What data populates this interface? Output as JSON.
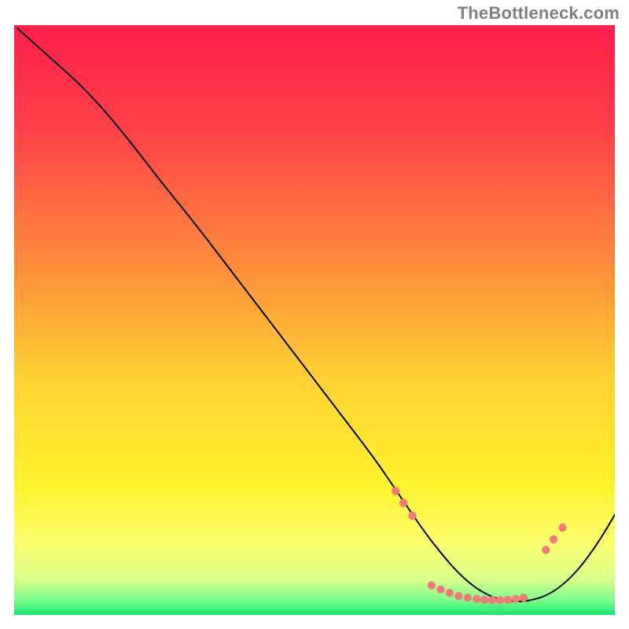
{
  "watermark": "TheBottleneck.com",
  "chart_data": {
    "type": "line",
    "title": "",
    "xlabel": "",
    "ylabel": "",
    "xlim": [
      0,
      100
    ],
    "ylim": [
      0,
      100
    ],
    "gradient_stops": [
      {
        "offset": 0.0,
        "color": "#ff1f4b"
      },
      {
        "offset": 0.18,
        "color": "#ff4249"
      },
      {
        "offset": 0.4,
        "color": "#ff8a3c"
      },
      {
        "offset": 0.6,
        "color": "#ffd233"
      },
      {
        "offset": 0.78,
        "color": "#fff22e"
      },
      {
        "offset": 0.88,
        "color": "#fdff6f"
      },
      {
        "offset": 0.94,
        "color": "#d8ff8a"
      },
      {
        "offset": 0.975,
        "color": "#7bff8e"
      },
      {
        "offset": 1.0,
        "color": "#19e56b"
      }
    ],
    "series": [
      {
        "name": "curve",
        "color": "#000000",
        "width": 2.0,
        "x": [
          0.5,
          6,
          12,
          18,
          24,
          30,
          36,
          42,
          48,
          54,
          60,
          64,
          68,
          71,
          74,
          77,
          80,
          83,
          86,
          89,
          92,
          95,
          98,
          100
        ],
        "y": [
          99.5,
          94.5,
          89,
          82,
          74,
          66.5,
          58.5,
          50.5,
          42.5,
          34.5,
          26.5,
          20.5,
          14.5,
          10.5,
          7.0,
          4.4,
          2.8,
          2.2,
          2.4,
          3.4,
          5.6,
          9.0,
          13.5,
          17.0
        ]
      }
    ],
    "markers": {
      "color": "#f47a7a",
      "radius": 5.2,
      "points": [
        {
          "x": 63.5,
          "y": 21.0
        },
        {
          "x": 64.8,
          "y": 19.0
        },
        {
          "x": 66.3,
          "y": 16.8
        },
        {
          "x": 69.5,
          "y": 5.0
        },
        {
          "x": 71.0,
          "y": 4.3
        },
        {
          "x": 72.5,
          "y": 3.7
        },
        {
          "x": 74.0,
          "y": 3.2
        },
        {
          "x": 75.5,
          "y": 2.9
        },
        {
          "x": 77.0,
          "y": 2.7
        },
        {
          "x": 78.3,
          "y": 2.55
        },
        {
          "x": 79.6,
          "y": 2.5
        },
        {
          "x": 80.9,
          "y": 2.5
        },
        {
          "x": 82.2,
          "y": 2.55
        },
        {
          "x": 83.5,
          "y": 2.7
        },
        {
          "x": 84.8,
          "y": 2.9
        },
        {
          "x": 88.5,
          "y": 11.0
        },
        {
          "x": 89.8,
          "y": 12.8
        },
        {
          "x": 91.3,
          "y": 14.8
        }
      ]
    }
  }
}
